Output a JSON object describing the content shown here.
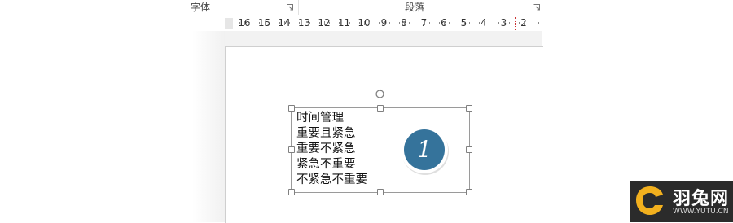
{
  "ribbon": {
    "font_group_label": "字体",
    "paragraph_group_label": "段落",
    "launcher_icon": "dialog-launcher-icon"
  },
  "ruler": {
    "numbers": [
      "16",
      "15",
      "14",
      "13",
      "12",
      "11",
      "10",
      "9",
      "8",
      "7",
      "6",
      "5",
      "4",
      "3",
      "2"
    ]
  },
  "slide": {
    "textbox_lines": [
      "时间管理",
      "重要且紧急",
      "重要不紧急",
      "紧急不重要",
      "不紧急不重要"
    ],
    "badge_number": "1",
    "badge_color": "#35739b",
    "rotate_icon": "rotate-handle-icon"
  },
  "watermark": {
    "name": "羽兔网",
    "url": "WWW.YUTU.CN",
    "accent": "#f2b01e"
  }
}
